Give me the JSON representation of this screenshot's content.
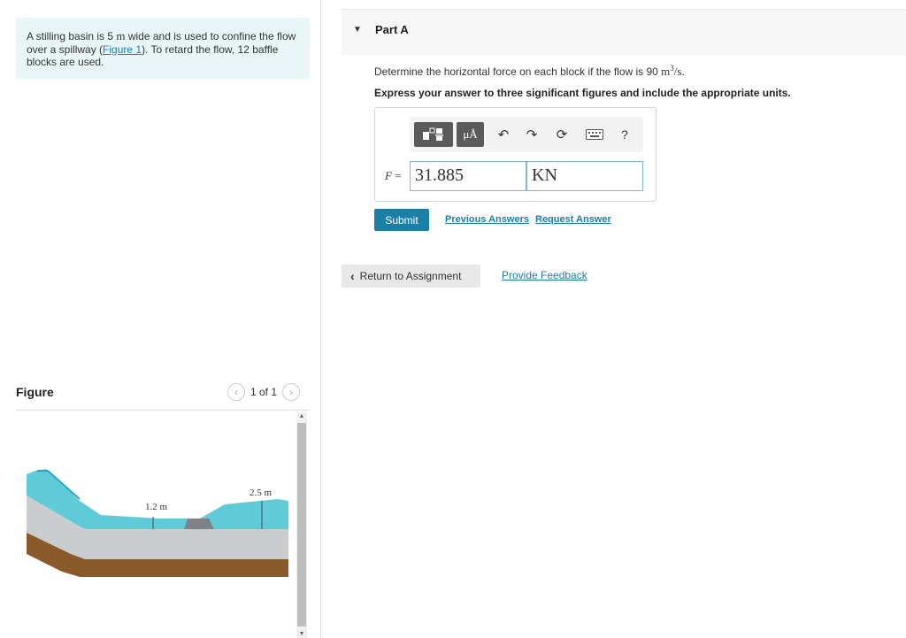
{
  "problem": {
    "text_before": "A stilling basin is 5 ",
    "unit_m": "m",
    "text_mid": " wide and is used to confine the flow over a spillway (",
    "figure_link": "Figure 1",
    "text_after": "). To retard the flow, 12 baffle blocks are used."
  },
  "figure": {
    "title": "Figure",
    "pager": "1 of 1",
    "prev_icon": "chevron-left-icon",
    "next_icon": "chevron-right-icon",
    "label_left": "1.2 m",
    "label_right": "2.5 m"
  },
  "part": {
    "title": "Part A",
    "question_before": "Determine the horizontal force on each block if the flow is 90 ",
    "question_unit": "m",
    "question_exp": "3",
    "question_after": "/s.",
    "instruction": "Express your answer to three significant figures and include the appropriate units."
  },
  "answer": {
    "variable": "F",
    "equals": "=",
    "value": "31.885",
    "units": "KN",
    "toolbar": {
      "units_label": "μÅ",
      "help_label": "?",
      "icons": [
        "templates-icon",
        "units-icon",
        "undo-icon",
        "redo-icon",
        "reset-icon",
        "keyboard-icon",
        "help-icon"
      ]
    }
  },
  "actions": {
    "submit": "Submit",
    "previous_answers": "Previous Answers",
    "request_answer": "Request Answer",
    "return_assignment": "Return to Assignment",
    "provide_feedback": "Provide Feedback"
  },
  "colors": {
    "accent": "#1b7fa6",
    "problem_bg": "#e9f5f7",
    "water": "#5fcbd8",
    "ground": "#8b5a2b"
  }
}
